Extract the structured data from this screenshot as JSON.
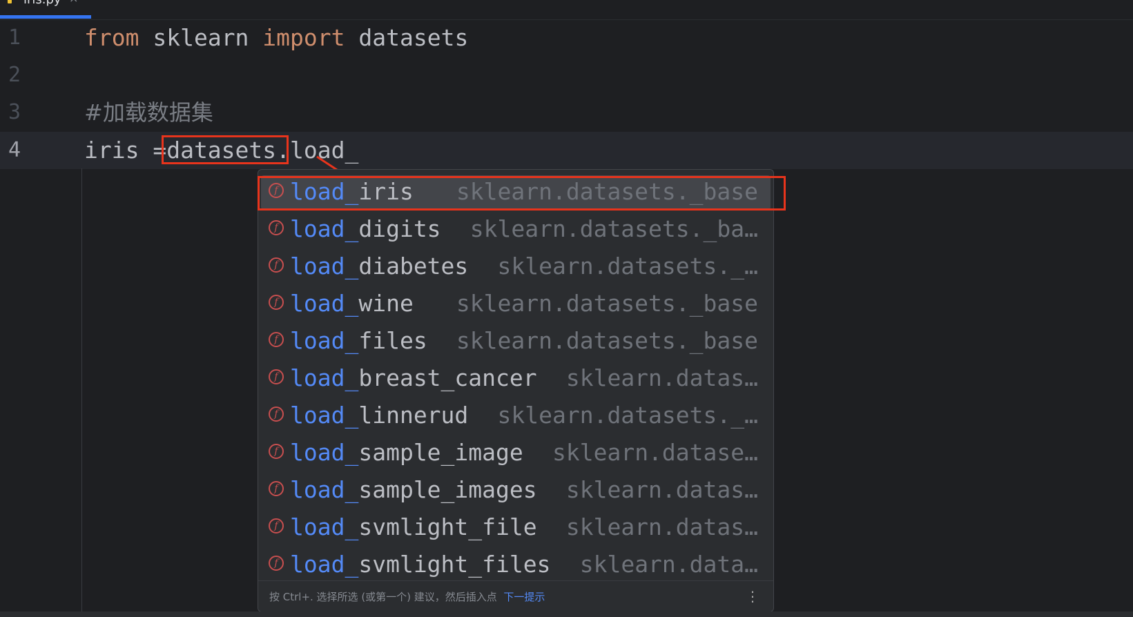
{
  "tab": {
    "label": "iris.py",
    "close": "×",
    "icon": "python-file-icon"
  },
  "editor": {
    "lines": [
      {
        "number": "1",
        "tokens": {
          "kw1": "from",
          "t1": " sklearn ",
          "kw2": "import",
          "t2": " datasets"
        }
      },
      {
        "number": "2"
      },
      {
        "number": "3",
        "comment": "#加载数据集"
      },
      {
        "number": "4",
        "code": "iris =datasets.load_"
      }
    ]
  },
  "completion": {
    "items": [
      {
        "match": "load_",
        "rest": "iris",
        "location": "sklearn.datasets._base",
        "selected": true
      },
      {
        "match": "load_",
        "rest": "digits",
        "location": "sklearn.datasets._ba…"
      },
      {
        "match": "load_",
        "rest": "diabetes",
        "location": "sklearn.datasets._…"
      },
      {
        "match": "load_",
        "rest": "wine",
        "location": "sklearn.datasets._base"
      },
      {
        "match": "load_",
        "rest": "files",
        "location": "sklearn.datasets._base"
      },
      {
        "match": "load_",
        "rest": "breast_cancer",
        "location": "sklearn.datas…"
      },
      {
        "match": "load_",
        "rest": "linnerud",
        "location": "sklearn.datasets._…"
      },
      {
        "match": "load_",
        "rest": "sample_image",
        "location": "sklearn.datase…"
      },
      {
        "match": "load_",
        "rest": "sample_images",
        "location": "sklearn.datas…"
      },
      {
        "match": "load_",
        "rest": "svmlight_file",
        "location": "sklearn.datas…"
      },
      {
        "match": "load_",
        "rest": "svmlight_files",
        "location": "sklearn.data…"
      }
    ],
    "footer": {
      "hint": "按 Ctrl+. 选择所选 (或第一个) 建议，然后插入点  ",
      "link": "下一提示",
      "menu": "⋮"
    }
  },
  "colors": {
    "accent": "#3574f0",
    "annotation": "#e8341c",
    "keyword": "#cf8e6d",
    "match": "#548af7"
  }
}
